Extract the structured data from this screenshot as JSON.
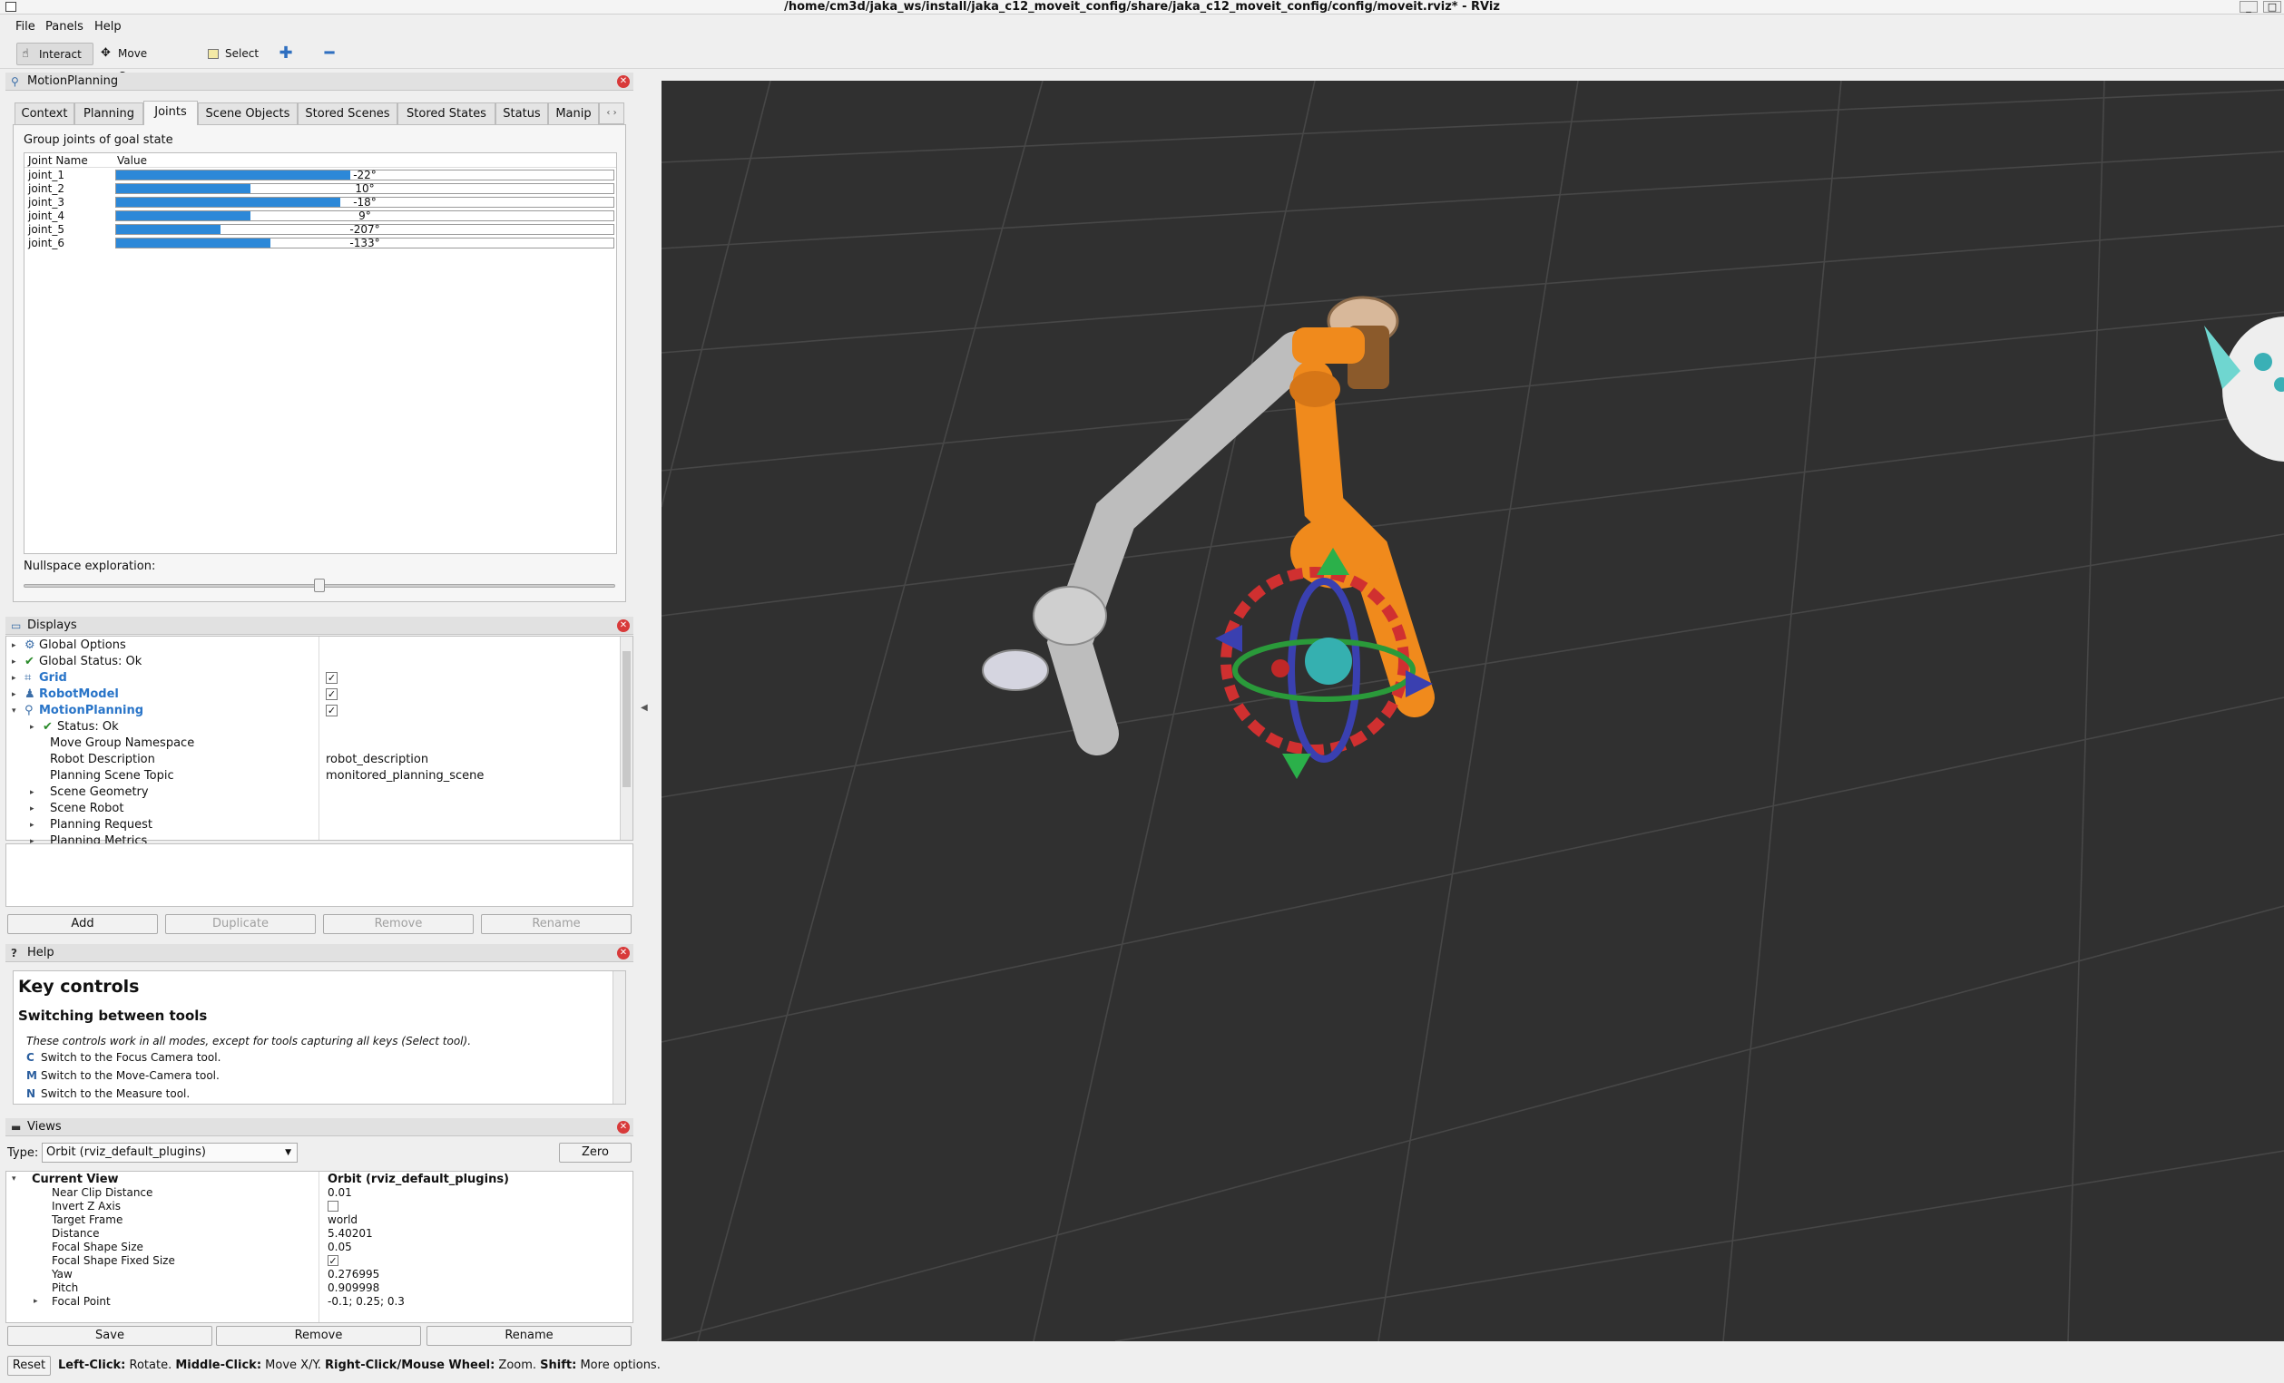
{
  "window": {
    "title": "/home/cm3d/jaka_ws/install/jaka_c12_moveit_config/share/jaka_c12_moveit_config/config/moveit.rviz* - RViz",
    "minimize_glyph": "_",
    "restore_glyph": "□"
  },
  "menu": [
    "File",
    "Panels",
    "Help"
  ],
  "toolbar": {
    "interact": "Interact",
    "move_camera": "Move Camera",
    "select": "Select"
  },
  "motion_planning": {
    "title": "MotionPlanning",
    "tabs": [
      "Context",
      "Planning",
      "Joints",
      "Scene Objects",
      "Stored Scenes",
      "Stored States",
      "Status",
      "Manip"
    ],
    "selected_tab": "Joints",
    "group_label": "Group joints of goal state",
    "col_name": "Joint Name",
    "col_value": "Value",
    "joints": [
      {
        "name": "joint_1",
        "value": "-22°",
        "fraction": 0.47
      },
      {
        "name": "joint_2",
        "value": "10°",
        "fraction": 0.27
      },
      {
        "name": "joint_3",
        "value": "-18°",
        "fraction": 0.45
      },
      {
        "name": "joint_4",
        "value": "9°",
        "fraction": 0.27
      },
      {
        "name": "joint_5",
        "value": "-207°",
        "fraction": 0.21
      },
      {
        "name": "joint_6",
        "value": "-133°",
        "fraction": 0.31
      }
    ],
    "nullspace_label": "Nullspace exploration:",
    "nullspace_fraction": 0.5
  },
  "displays": {
    "title": "Displays",
    "items": [
      {
        "label": "Global Options",
        "value": ""
      },
      {
        "label": "Global Status: Ok",
        "value": ""
      },
      {
        "label": "Grid",
        "value": "✓"
      },
      {
        "label": "RobotModel",
        "value": "✓"
      },
      {
        "label": "MotionPlanning",
        "value": "✓"
      },
      {
        "label": "Status: Ok",
        "value": ""
      },
      {
        "label": "Move Group Namespace",
        "value": ""
      },
      {
        "label": "Robot Description",
        "value": "robot_description"
      },
      {
        "label": "Planning Scene Topic",
        "value": "monitored_planning_scene"
      },
      {
        "label": "Scene Geometry",
        "value": ""
      },
      {
        "label": "Scene Robot",
        "value": ""
      },
      {
        "label": "Planning Request",
        "value": ""
      },
      {
        "label": "Planning Metrics",
        "value": ""
      }
    ],
    "buttons": [
      "Add",
      "Duplicate",
      "Remove",
      "Rename"
    ]
  },
  "help": {
    "title": "Help",
    "heading": "Key controls",
    "subheading": "Switching between tools",
    "intro": "These controls work in all modes, except for tools capturing all keys (Select tool).",
    "keys": [
      {
        "key": "C",
        "text": "Switch to the Focus Camera tool."
      },
      {
        "key": "M",
        "text": "Switch to the Move-Camera tool."
      },
      {
        "key": "N",
        "text": "Switch to the Measure tool."
      }
    ]
  },
  "views": {
    "title": "Views",
    "type_label": "Type:",
    "type_value": "Orbit (rviz_default_plugins)",
    "zero": "Zero",
    "current_view": "Current View",
    "current_view_value": "Orbit (rviz_default_plugins)",
    "props": [
      {
        "label": "Near Clip Distance",
        "value": "0.01"
      },
      {
        "label": "Invert Z Axis",
        "value": ""
      },
      {
        "label": "Target Frame",
        "value": "world"
      },
      {
        "label": "Distance",
        "value": "5.40201"
      },
      {
        "label": "Focal Shape Size",
        "value": "0.05"
      },
      {
        "label": "Focal Shape Fixed Size",
        "value": "✓"
      },
      {
        "label": "Yaw",
        "value": "0.276995"
      },
      {
        "label": "Pitch",
        "value": "0.909998"
      },
      {
        "label": "Focal Point",
        "value": "-0.1; 0.25; 0.3"
      }
    ],
    "buttons": [
      "Save",
      "Remove",
      "Rename"
    ]
  },
  "status": {
    "reset": "Reset",
    "segments": [
      {
        "bold": "Left-Click:",
        "text": " Rotate. "
      },
      {
        "bold": "Middle-Click:",
        "text": " Move X/Y. "
      },
      {
        "bold": "Right-Click/Mouse Wheel:",
        "text": " Zoom. "
      },
      {
        "bold": "Shift:",
        "text": " More options."
      }
    ]
  },
  "colors": {
    "viewport_bg": "#303030",
    "grid": "#4a4a4a",
    "robot_orange": "#f08a1c",
    "robot_gray": "#bdbdbd",
    "bar_fill": "#2c88d8"
  }
}
